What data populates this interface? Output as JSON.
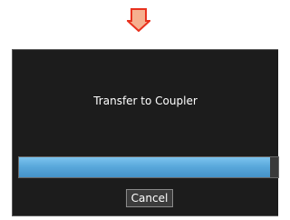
{
  "indicator": {
    "icon": "down-arrow-icon",
    "fill_color": "#f6b08f",
    "stroke_color": "#e8321e"
  },
  "dialog": {
    "title": "Transfer to Coupler",
    "progress": {
      "percent": 97,
      "fill_color": "#5aa9dc"
    },
    "cancel_label": "Cancel"
  }
}
